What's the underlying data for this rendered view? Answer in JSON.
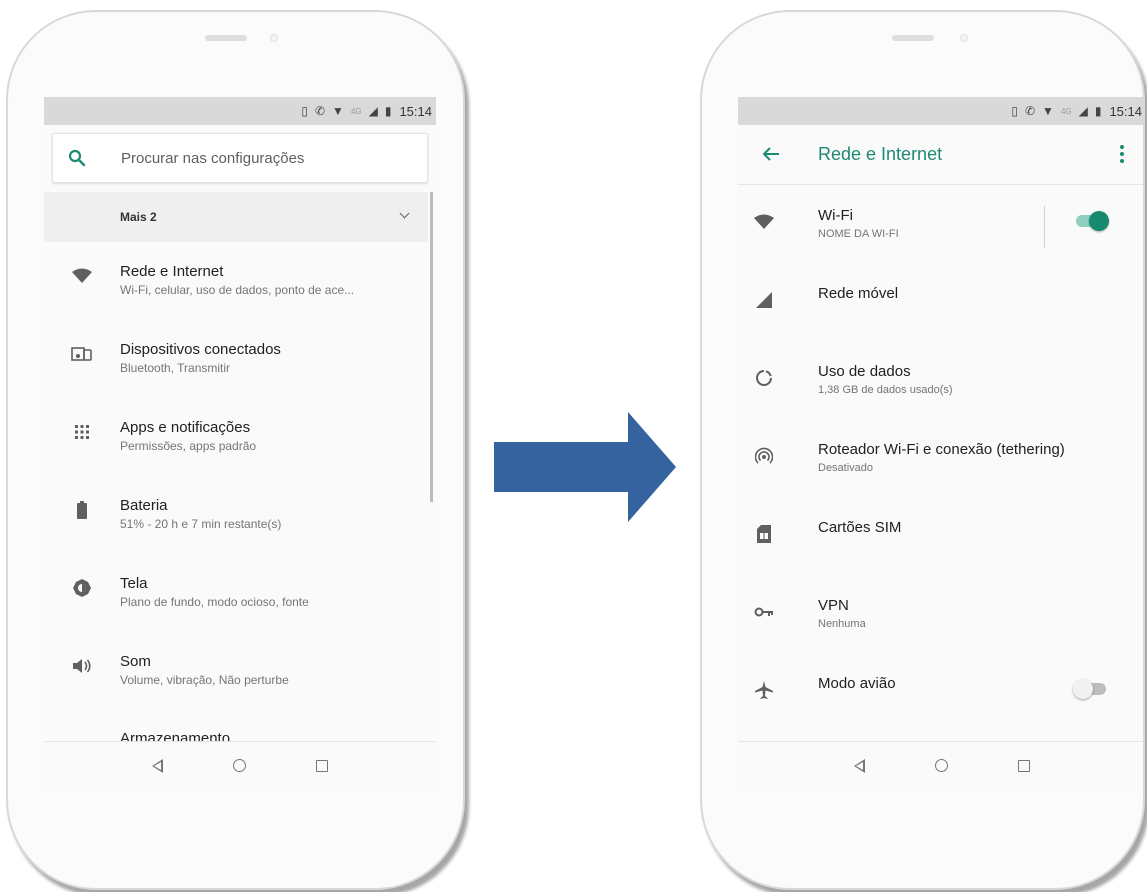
{
  "left_phone": {
    "status_time": "15:14",
    "status_network": "4G",
    "search_placeholder": "Procurar nas configurações",
    "more_label": "Mais 2",
    "items": [
      {
        "title": "Rede e Internet",
        "summary": "Wi-Fi, celular, uso de dados, ponto de ace...",
        "icon": "wifi-icon"
      },
      {
        "title": "Dispositivos conectados",
        "summary": "Bluetooth, Transmitir",
        "icon": "devices-icon"
      },
      {
        "title": "Apps e notificações",
        "summary": "Permissões, apps padrão",
        "icon": "apps-grid-icon"
      },
      {
        "title": "Bateria",
        "summary": "51% - 20 h e 7 min restante(s)",
        "icon": "battery-icon"
      },
      {
        "title": "Tela",
        "summary": "Plano de fundo, modo ocioso, fonte",
        "icon": "brightness-icon"
      },
      {
        "title": "Som",
        "summary": "Volume, vibração, Não perturbe",
        "icon": "volume-icon"
      },
      {
        "title": "Armazenamento",
        "summary": "",
        "icon": ""
      }
    ]
  },
  "right_phone": {
    "status_time": "15:14",
    "status_network": "4G",
    "title": "Rede e Internet",
    "accent_color": "#1c8a73",
    "items": [
      {
        "title": "Wi-Fi",
        "summary": "NOME DA WI-FI",
        "icon": "wifi-icon",
        "toggle": "on"
      },
      {
        "title": "Rede móvel",
        "summary": "",
        "icon": "signal-icon"
      },
      {
        "title": "Uso de dados",
        "summary": "1,38 GB de dados usado(s)",
        "icon": "data-usage-icon"
      },
      {
        "title": "Roteador Wi-Fi e conexão (tethering)",
        "summary": "Desativado",
        "icon": "hotspot-icon"
      },
      {
        "title": "Cartões SIM",
        "summary": "",
        "icon": "sim-card-icon"
      },
      {
        "title": "VPN",
        "summary": "Nenhuma",
        "icon": "key-icon"
      },
      {
        "title": "Modo avião",
        "summary": "",
        "icon": "airplane-icon",
        "toggle": "off"
      }
    ]
  },
  "arrow_color": "#3563a0"
}
